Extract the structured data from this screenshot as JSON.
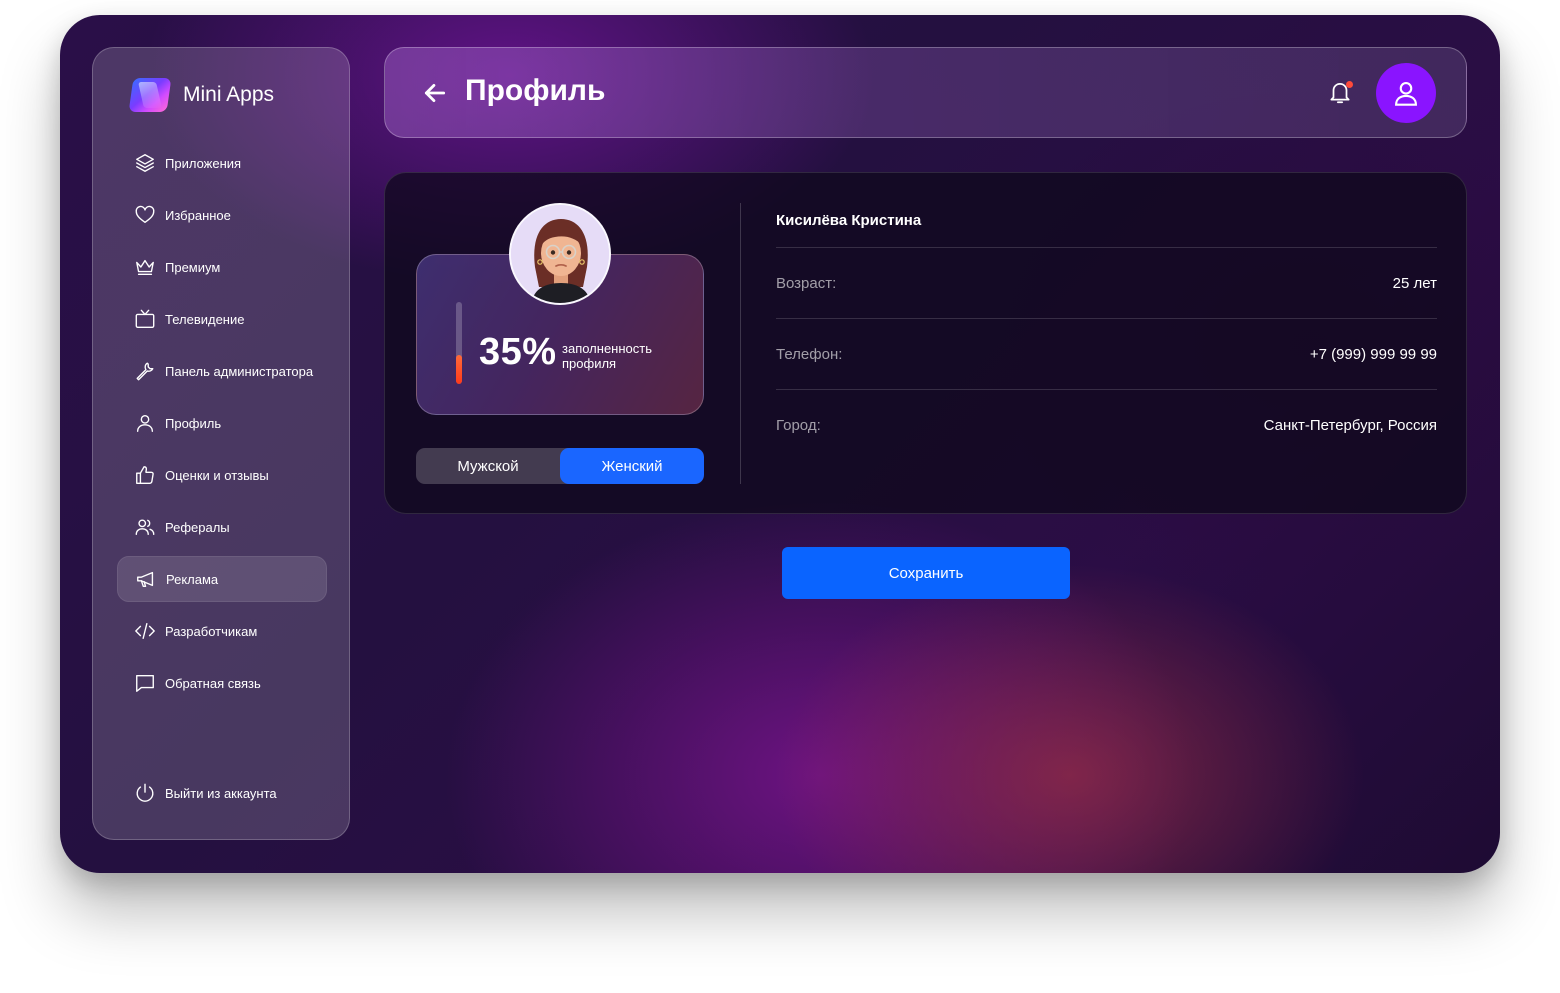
{
  "brand": {
    "name": "Mini Apps"
  },
  "sidebar": {
    "items": [
      {
        "label": "Приложения",
        "icon": "layers-icon"
      },
      {
        "label": "Избранное",
        "icon": "heart-icon"
      },
      {
        "label": "Премиум",
        "icon": "crown-icon"
      },
      {
        "label": "Телевидение",
        "icon": "tv-icon"
      },
      {
        "label": "Панель администратора",
        "icon": "wrench-icon"
      },
      {
        "label": "Профиль",
        "icon": "user-icon"
      },
      {
        "label": "Оценки и отзывы",
        "icon": "thumbs-up-icon"
      },
      {
        "label": "Рефералы",
        "icon": "users-icon"
      },
      {
        "label": "Реклама",
        "icon": "megaphone-icon",
        "active": true
      },
      {
        "label": "Разработчикам",
        "icon": "code-icon"
      },
      {
        "label": "Обратная связь",
        "icon": "message-icon"
      }
    ],
    "logout": {
      "label": "Выйти из аккаунта",
      "icon": "power-icon"
    }
  },
  "header": {
    "title": "Профиль"
  },
  "profile": {
    "fill_percent": 35,
    "fill_percent_text": "35%",
    "fill_label": "заполненность профиля",
    "gender": {
      "options": [
        "Мужской",
        "Женский"
      ],
      "selected": "Женский"
    },
    "name": "Кисилёва Кристина",
    "fields": [
      {
        "key": "Возраст:",
        "value": "25 лет"
      },
      {
        "key": "Телефон:",
        "value": "+7 (999) 999 99 99"
      },
      {
        "key": "Город:",
        "value": "Санкт-Петербург, Россия"
      }
    ]
  },
  "actions": {
    "save_label": "Сохранить"
  },
  "colors": {
    "accent": "#0a64ff",
    "avatar_bg": "#8a14ff",
    "notification_dot": "#ff4a3a",
    "progress": "#ff3a1a"
  }
}
